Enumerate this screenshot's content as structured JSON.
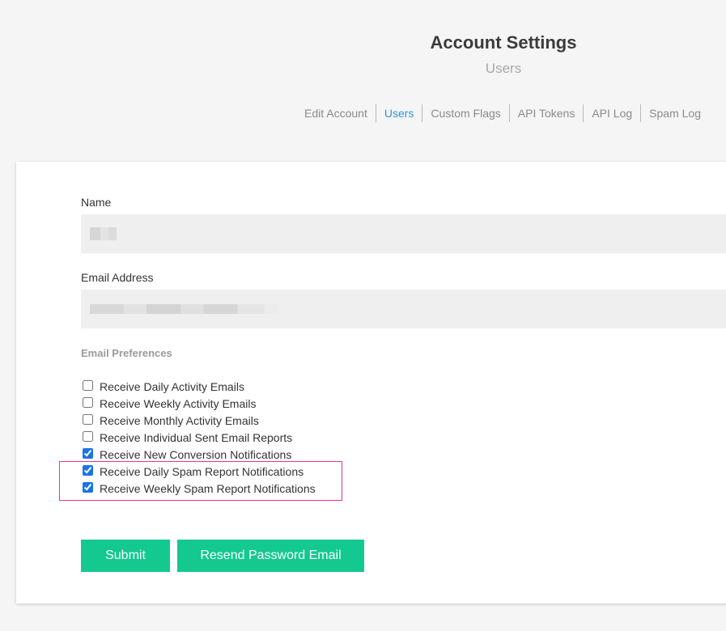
{
  "header": {
    "title": "Account Settings",
    "subtitle": "Users"
  },
  "tabs": [
    {
      "label": "Edit Account",
      "active": false
    },
    {
      "label": "Users",
      "active": true
    },
    {
      "label": "Custom Flags",
      "active": false
    },
    {
      "label": "API Tokens",
      "active": false
    },
    {
      "label": "API Log",
      "active": false
    },
    {
      "label": "Spam Log",
      "active": false
    }
  ],
  "form": {
    "name_label": "Name",
    "name_value": "",
    "email_label": "Email Address",
    "email_value": "",
    "preferences_label": "Email Preferences",
    "preferences": [
      {
        "label": "Receive Daily Activity Emails",
        "checked": false
      },
      {
        "label": "Receive Weekly Activity Emails",
        "checked": false
      },
      {
        "label": "Receive Monthly Activity Emails",
        "checked": false
      },
      {
        "label": "Receive Individual Sent Email Reports",
        "checked": false
      },
      {
        "label": "Receive New Conversion Notifications",
        "checked": true
      },
      {
        "label": "Receive Daily Spam Report Notifications",
        "checked": true
      },
      {
        "label": "Receive Weekly Spam Report Notifications",
        "checked": true
      }
    ]
  },
  "buttons": {
    "submit_label": "Submit",
    "resend_label": "Resend Password Email"
  },
  "colors": {
    "accent_button": "#13c990",
    "active_tab": "#2c97de",
    "highlight_outline": "#e0359b"
  }
}
